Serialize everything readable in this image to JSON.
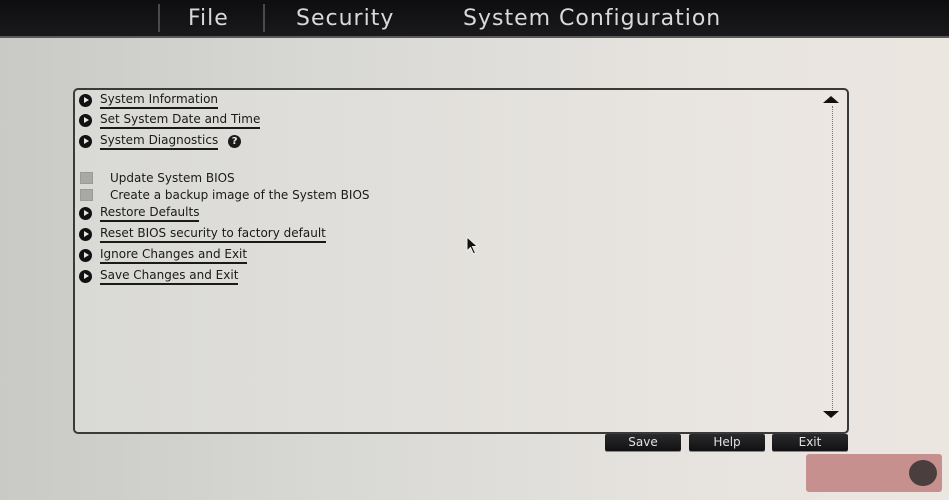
{
  "menu": {
    "tabs": [
      "File",
      "Security",
      "System Configuration"
    ]
  },
  "main": {
    "items": [
      {
        "type": "link",
        "label": "System Information"
      },
      {
        "type": "link",
        "label": "Set System Date and Time"
      },
      {
        "type": "link",
        "label": "System Diagnostics",
        "help_icon": "?"
      },
      {
        "type": "checkbox",
        "label": "Update System BIOS"
      },
      {
        "type": "checkbox",
        "label": "Create a backup image of the System BIOS"
      },
      {
        "type": "link",
        "label": "Restore Defaults"
      },
      {
        "type": "link",
        "label": "Reset BIOS security to factory default"
      },
      {
        "type": "link",
        "label": "Ignore Changes and Exit"
      },
      {
        "type": "link",
        "label": "Save Changes and Exit"
      }
    ]
  },
  "buttons": {
    "save": "Save",
    "help": "Help",
    "exit": "Exit"
  },
  "icons": {
    "bullet": "play-circle-icon",
    "help": "question-circle-icon",
    "scroll_up": "triangle-up-icon",
    "scroll_down": "triangle-down-icon",
    "cursor": "mouse-pointer-icon"
  },
  "colors": {
    "topbar": "#0e0e10",
    "panel_bg": "#e2e0dc",
    "button_bg": "#1a1a1c",
    "text": "#1a1a1a"
  }
}
